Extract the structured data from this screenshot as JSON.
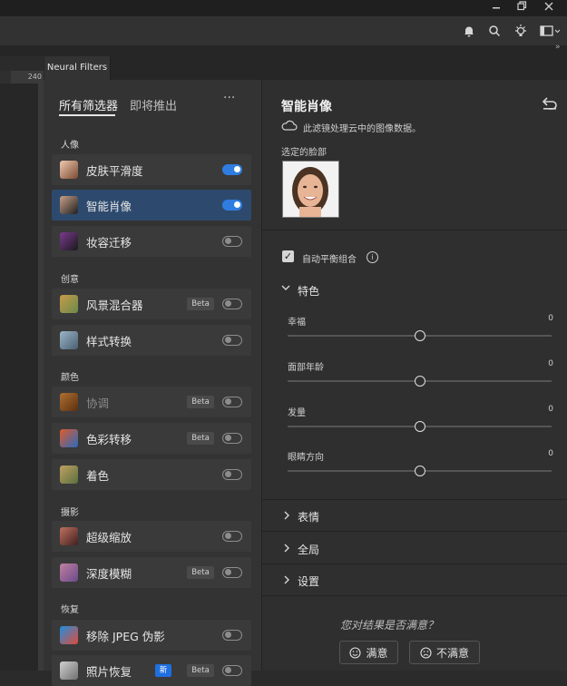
{
  "panel_tab": "Neural Filters",
  "ruler_value": "240",
  "nav": {
    "all": "所有筛选器",
    "soon": "即将推出",
    "more": "···"
  },
  "sections": {
    "portrait": "人像",
    "creative": "创意",
    "color": "颜色",
    "photography": "摄影",
    "restoration": "恢复"
  },
  "filters": [
    {
      "label": "皮肤平滑度",
      "badge": "",
      "toggle": "on",
      "active": false,
      "disabled": false
    },
    {
      "label": "智能肖像",
      "badge": "",
      "toggle": "on",
      "active": true,
      "disabled": false
    },
    {
      "label": "妆容迁移",
      "badge": "",
      "toggle": "off",
      "active": false,
      "disabled": false
    },
    {
      "label": "风景混合器",
      "badge": "Beta",
      "toggle": "off",
      "active": false,
      "disabled": false
    },
    {
      "label": "样式转换",
      "badge": "",
      "toggle": "off",
      "active": false,
      "disabled": false
    },
    {
      "label": "协调",
      "badge": "Beta",
      "toggle": "off",
      "active": false,
      "disabled": true
    },
    {
      "label": "色彩转移",
      "badge": "Beta",
      "toggle": "off",
      "active": false,
      "disabled": false
    },
    {
      "label": "着色",
      "badge": "",
      "toggle": "off",
      "active": false,
      "disabled": false
    },
    {
      "label": "超级缩放",
      "badge": "",
      "toggle": "off",
      "active": false,
      "disabled": false
    },
    {
      "label": "深度模糊",
      "badge": "Beta",
      "toggle": "off",
      "active": false,
      "disabled": false
    },
    {
      "label": "移除 JPEG 伪影",
      "badge": "",
      "toggle": "off",
      "active": false,
      "disabled": false
    },
    {
      "label": "照片恢复",
      "badge": "Beta",
      "new_badge": "新",
      "toggle": "off",
      "active": false,
      "disabled": false
    }
  ],
  "detail": {
    "title": "智能肖像",
    "cloud_note": "此滤镜处理云中的图像数据。",
    "selected_face_label": "选定的脸部",
    "auto_balance_label": "自动平衡组合",
    "auto_balance_checked": true,
    "features_label": "特色",
    "sliders": [
      {
        "label": "幸福",
        "value": "0",
        "level": 0.5
      },
      {
        "label": "面部年龄",
        "value": "0",
        "level": 0.5
      },
      {
        "label": "发量",
        "value": "0",
        "level": 0.5
      },
      {
        "label": "眼睛方向",
        "value": "0",
        "level": 0.5
      }
    ],
    "collapsed_sections": [
      "表情",
      "全局",
      "设置"
    ],
    "feedback_question": "您对结果是否满意？",
    "satisfied": "满意",
    "unsatisfied": "不满意"
  },
  "colors": {
    "accent": "#2f7de1",
    "active_row": "#2d4a6e",
    "panel": "#333333"
  }
}
